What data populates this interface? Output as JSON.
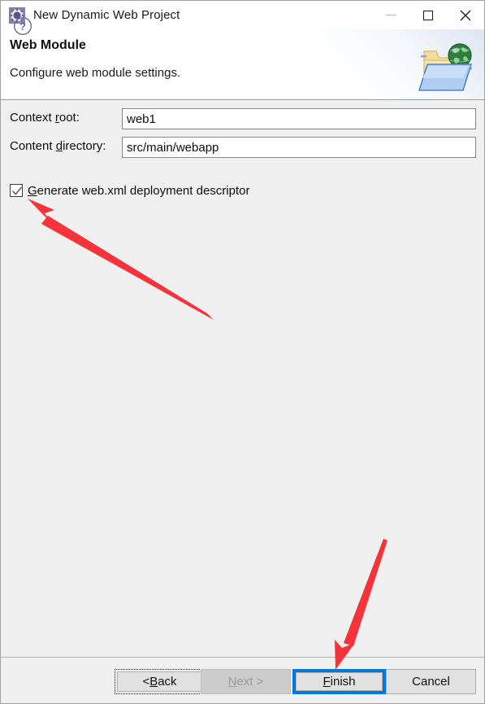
{
  "window": {
    "title": "New Dynamic Web Project",
    "icon": "eclipse-wizard-icon",
    "controls": {
      "minimize": "minimize-icon",
      "maximize": "maximize-icon",
      "close": "close-icon"
    }
  },
  "header": {
    "title": "Web Module",
    "subtitle": "Configure web module settings.",
    "graphic": "web-folder-globe-icon"
  },
  "form": {
    "fields": [
      {
        "label_pre": "Context ",
        "label_mnemonic": "r",
        "label_post": "oot:",
        "value": "web1",
        "placeholder": ""
      },
      {
        "label_pre": "Content ",
        "label_mnemonic": "d",
        "label_post": "irectory:",
        "value": "src/main/webapp",
        "placeholder": ""
      }
    ],
    "checkbox": {
      "label_mnemonic": "G",
      "label_post": "enerate web.xml deployment descriptor",
      "checked": true
    }
  },
  "footer": {
    "help": "help-icon",
    "buttons": [
      {
        "name": "back",
        "label_pre": "< ",
        "label_mnemonic": "B",
        "label_post": "ack",
        "state": "focused"
      },
      {
        "name": "next",
        "label_pre": "",
        "label_mnemonic": "N",
        "label_post": "ext >",
        "state": "disabled"
      },
      {
        "name": "finish",
        "label_pre": "",
        "label_mnemonic": "F",
        "label_post": "inish",
        "state": "default"
      },
      {
        "name": "cancel",
        "label_pre": "Cancel",
        "label_mnemonic": "",
        "label_post": "",
        "state": "normal"
      }
    ]
  },
  "annotations": {
    "arrow_color": "#f5333a",
    "arrows": [
      {
        "name": "arrow-to-checkbox",
        "points_to": "Generate web.xml deployment descriptor"
      },
      {
        "name": "arrow-to-finish",
        "points_to": "Finish"
      }
    ]
  },
  "colors": {
    "accent": "#0078d7",
    "dialog_bg": "#f0f0f0",
    "header_bg": "#ffffff",
    "text": "#0d0d0d",
    "arrow": "#f5333a"
  }
}
